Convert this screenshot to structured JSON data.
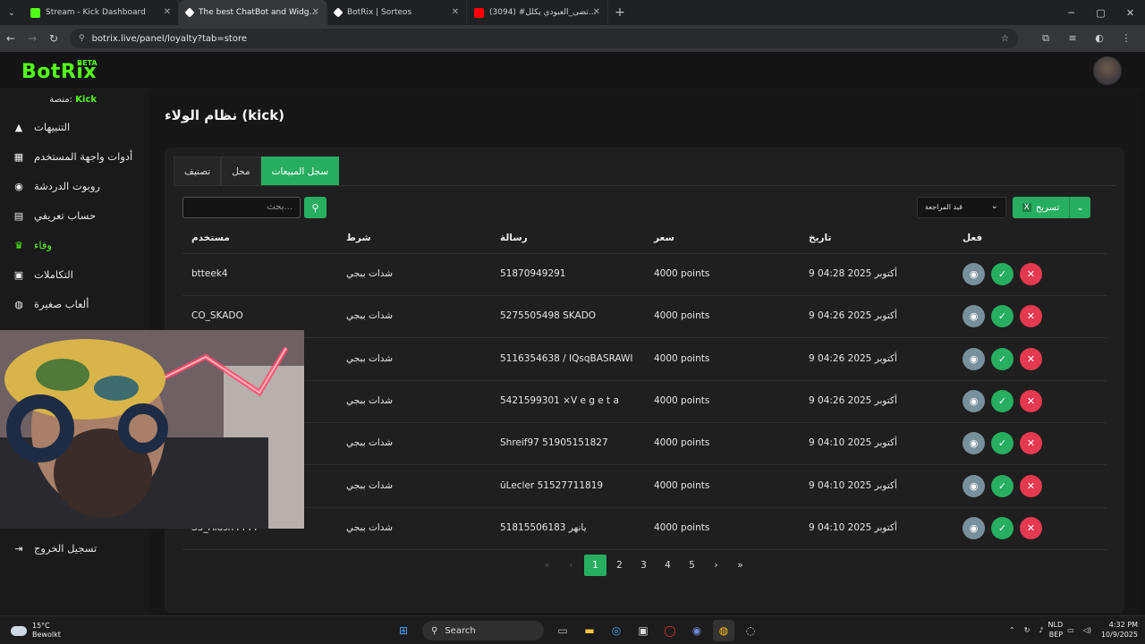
{
  "browser": {
    "tabs": [
      {
        "title": "Stream - Kick Dashboard",
        "favicon_color": "#53fc18"
      },
      {
        "title": "The best ChatBot and Widgets",
        "favicon_color": "#ffffff"
      },
      {
        "title": "BotRix | Sorteos",
        "favicon_color": "#ffffff"
      },
      {
        "title": "(3094) #مرتضى_العبودي يكلل...",
        "favicon_color": "#ff0000"
      }
    ],
    "url": "botrix.live/panel/loyalty?tab=store"
  },
  "header": {
    "logo": "BotRix",
    "beta": "BETA"
  },
  "sidebar": {
    "platform_label": "منصة:",
    "platform_value": "Kick",
    "items": [
      {
        "label": "التنبيهات",
        "icon": "warning-icon"
      },
      {
        "label": "أدوات واجهة المستخدم",
        "icon": "widgets-icon"
      },
      {
        "label": "روبوت الدردشة",
        "icon": "robot-icon"
      },
      {
        "label": "حساب تعريفي",
        "icon": "id-card-icon"
      },
      {
        "label": "وفاء",
        "icon": "trophy-icon"
      },
      {
        "label": "التكاملات",
        "icon": "chat-icon"
      },
      {
        "label": "ألعاب صغيرة",
        "icon": "gamepad-icon"
      }
    ],
    "logout": "تسجيل الخروج"
  },
  "main": {
    "title": "نظام الولاء (kick)",
    "tabs": [
      "سجل المبيعات",
      "محل",
      "تصنيف"
    ],
    "search_placeholder": "...بحث",
    "filter_value": "قيد المراجعة",
    "export_label": "تسريح",
    "columns": [
      "فعل",
      "تاريخ",
      "سعر",
      "رسالة",
      "شرط",
      "مستخدم"
    ],
    "rows": [
      {
        "user": "btteek4",
        "condition": "شدات ببجي",
        "message": "51870949291",
        "price": "4000 points",
        "date": "9 أكتوبر 2025 04:28"
      },
      {
        "user": "CO_SKADO",
        "condition": "شدات ببجي",
        "message": "5275505498 SKADO",
        "price": "4000 points",
        "date": "9 أكتوبر 2025 04:26"
      },
      {
        "user": "",
        "condition": "شدات ببجي",
        "message": "5116354638 / IQsqBASRAWI",
        "price": "4000 points",
        "date": "9 أكتوبر 2025 04:26"
      },
      {
        "user": "",
        "condition": "شدات ببجي",
        "message": "5421599301 ×V e g e t a",
        "price": "4000 points",
        "date": "9 أكتوبر 2025 04:26"
      },
      {
        "user": "",
        "condition": "شدات ببجي",
        "message": "Shreif97 51905151827",
        "price": "4000 points",
        "date": "9 أكتوبر 2025 04:10"
      },
      {
        "user": "",
        "condition": "شدات ببجي",
        "message": "ūLecler 51527711819",
        "price": "4000 points",
        "date": "9 أكتوبر 2025 04:10"
      },
      {
        "user": "S3_Alosh4444",
        "condition": "شدات ببجي",
        "message": "51815506183 يانهر",
        "price": "4000 points",
        "date": "9 أكتوبر 2025 04:10"
      }
    ],
    "pagination": {
      "pages": [
        "1",
        "2",
        "3",
        "4",
        "5"
      ],
      "current": "1"
    }
  },
  "taskbar": {
    "temp": "15°C",
    "weather": "Bewolkt",
    "search": "Search",
    "lang1": "NLD",
    "lang2": "BEP",
    "time": "4:32 PM",
    "date": "10/9/2025"
  },
  "colors": {
    "brand": "#53fc18",
    "accent": "#27ae60",
    "danger": "#e53950",
    "neutral": "#78909c"
  }
}
